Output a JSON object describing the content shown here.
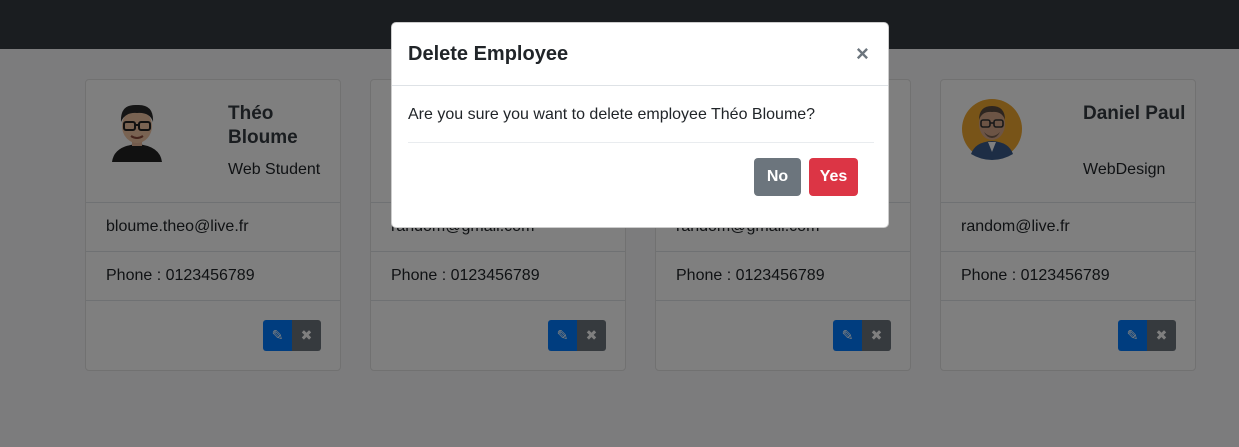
{
  "employees": [
    {
      "name": "Théo Bloume",
      "job": "Web Student",
      "email": "bloume.theo@live.fr",
      "phone": "Phone : 0123456789"
    },
    {
      "name": "",
      "job": "",
      "email": "random@gmail.com",
      "phone": "Phone : 0123456789"
    },
    {
      "name": "",
      "job": "",
      "email": "random@gmail.com",
      "phone": "Phone : 0123456789"
    },
    {
      "name": "Daniel Paul",
      "job": "WebDesign",
      "email": "random@live.fr",
      "phone": "Phone : 0123456789"
    }
  ],
  "card_actions": {
    "edit_icon": "pencil-icon",
    "delete_icon": "close-icon",
    "edit_color": "#007bff",
    "delete_color": "#6c757d"
  },
  "modal": {
    "title": "Delete Employee",
    "close": "×",
    "message": "Are you sure you want to delete employee Théo Bloume?",
    "no_label": "No",
    "yes_label": "Yes",
    "no_color": "#6c757d",
    "yes_color": "#dc3545"
  },
  "navbar": {
    "color": "#343a40"
  }
}
